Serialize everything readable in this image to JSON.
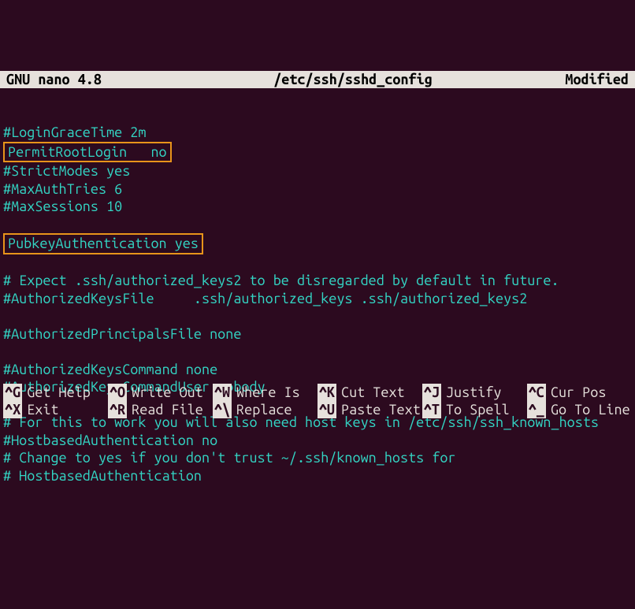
{
  "title_bar": {
    "app": "GNU nano 4.8",
    "file": "/etc/ssh/sshd_config",
    "status": "Modified"
  },
  "lines": [
    {
      "text": "#LoginGraceTime 2m",
      "highlighted": false
    },
    {
      "text": "PermitRootLogin   no",
      "highlighted": true
    },
    {
      "text": "#StrictModes yes",
      "highlighted": false
    },
    {
      "text": "#MaxAuthTries 6",
      "highlighted": false
    },
    {
      "text": "#MaxSessions 10",
      "highlighted": false
    },
    {
      "text": "",
      "highlighted": false
    },
    {
      "text": "PubkeyAuthentication yes",
      "highlighted": true
    },
    {
      "text": "",
      "highlighted": false
    },
    {
      "text": "# Expect .ssh/authorized_keys2 to be disregarded by default in future.",
      "highlighted": false
    },
    {
      "text": "#AuthorizedKeysFile     .ssh/authorized_keys .ssh/authorized_keys2",
      "highlighted": false
    },
    {
      "text": "",
      "highlighted": false
    },
    {
      "text": "#AuthorizedPrincipalsFile none",
      "highlighted": false
    },
    {
      "text": "",
      "highlighted": false
    },
    {
      "text": "#AuthorizedKeysCommand none",
      "highlighted": false
    },
    {
      "text": "#AuthorizedKeysCommandUser nobody",
      "highlighted": false
    },
    {
      "text": "",
      "highlighted": false
    },
    {
      "text": "# For this to work you will also need host keys in /etc/ssh/ssh_known_hosts",
      "highlighted": false
    },
    {
      "text": "#HostbasedAuthentication no",
      "highlighted": false
    },
    {
      "text": "# Change to yes if you don't trust ~/.ssh/known_hosts for",
      "highlighted": false
    },
    {
      "text": "# HostbasedAuthentication",
      "highlighted": false
    }
  ],
  "shortcuts": [
    {
      "key": "^G",
      "label": "Get Help"
    },
    {
      "key": "^O",
      "label": "Write Out"
    },
    {
      "key": "^W",
      "label": "Where Is"
    },
    {
      "key": "^K",
      "label": "Cut Text"
    },
    {
      "key": "^J",
      "label": "Justify"
    },
    {
      "key": "^C",
      "label": "Cur Pos"
    },
    {
      "key": "^X",
      "label": "Exit"
    },
    {
      "key": "^R",
      "label": "Read File"
    },
    {
      "key": "^\\",
      "label": "Replace"
    },
    {
      "key": "^U",
      "label": "Paste Text"
    },
    {
      "key": "^T",
      "label": "To Spell"
    },
    {
      "key": "^_",
      "label": "Go To Line"
    }
  ]
}
